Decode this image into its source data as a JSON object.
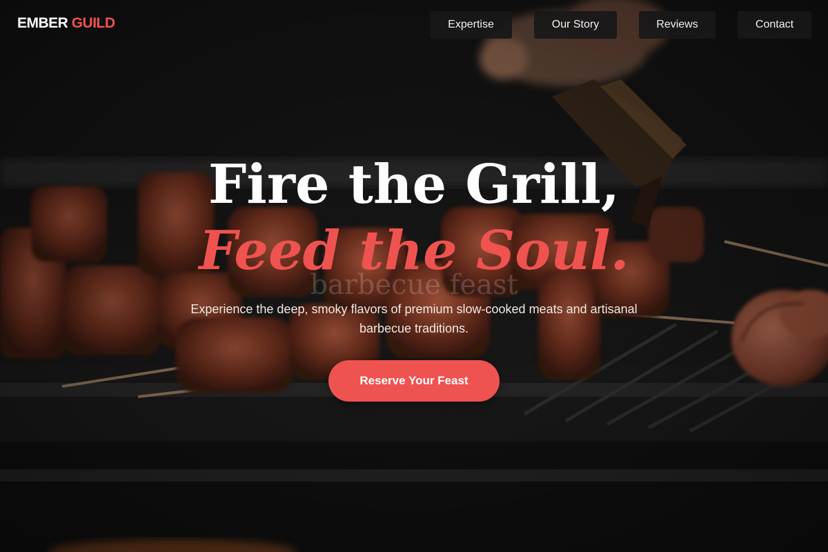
{
  "brand": {
    "name_part1": "EMBER",
    "name_part2": "GUILD"
  },
  "nav": {
    "items": [
      {
        "label": "Expertise"
      },
      {
        "label": "Our Story"
      },
      {
        "label": "Reviews"
      },
      {
        "label": "Contact"
      }
    ]
  },
  "hero": {
    "title_line1": "Fire the Grill,",
    "title_line2": "Feed the Soul.",
    "image_alt": "barbecue feast",
    "subtitle": "Experience the deep, smoky flavors of premium slow-cooked meats and artisanal barbecue traditions.",
    "cta_label": "Reserve Your Feast"
  },
  "colors": {
    "accent": "#ef5350",
    "nav_button_bg": "#181818",
    "text_light": "#ffffff"
  }
}
